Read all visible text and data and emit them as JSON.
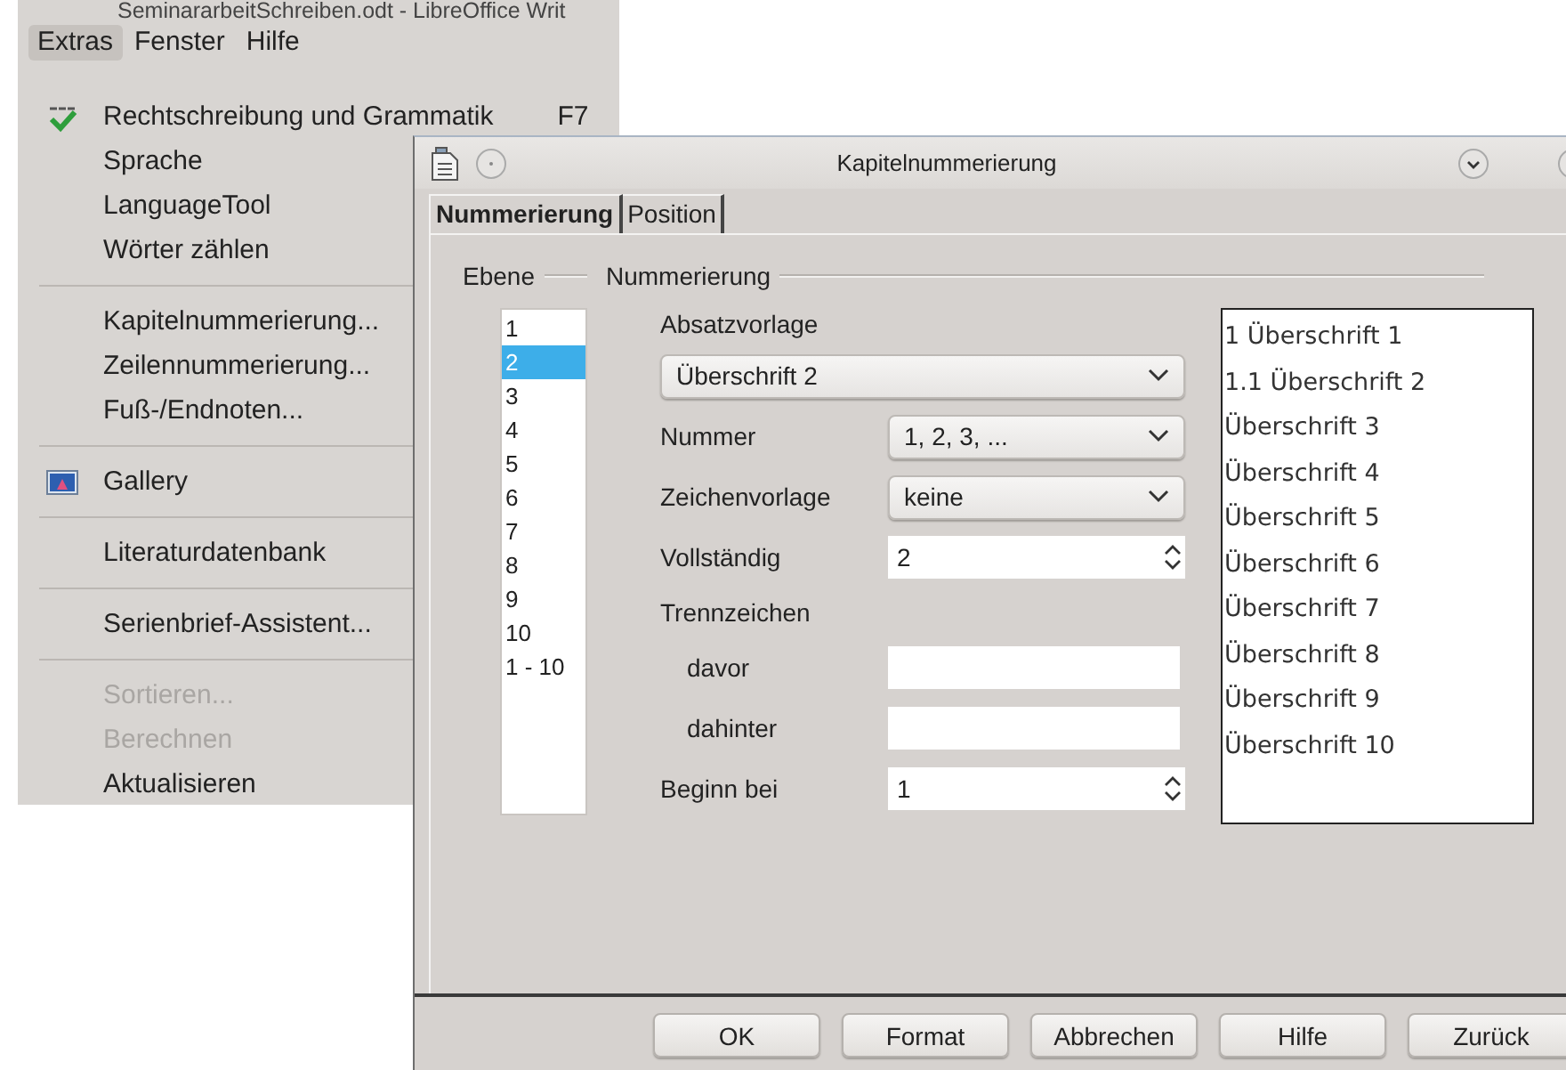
{
  "app_window": {
    "title": "SeminararbeitSchreiben.odt - LibreOffice Writ"
  },
  "menubar": [
    {
      "label": "Extras",
      "selected": true
    },
    {
      "label": "Fenster",
      "selected": false
    },
    {
      "label": "Hilfe",
      "selected": false
    }
  ],
  "menu": [
    {
      "kind": "item",
      "label": "Rechtschreibung und Grammatik",
      "shortcut": "F7",
      "disabled": false
    },
    {
      "kind": "item",
      "label": "Sprache",
      "disabled": false
    },
    {
      "kind": "item",
      "label": "LanguageTool",
      "disabled": false
    },
    {
      "kind": "item",
      "label": "Wörter zählen",
      "disabled": false
    },
    {
      "kind": "separator"
    },
    {
      "kind": "item",
      "label": "Kapitelnummerierung...",
      "disabled": false
    },
    {
      "kind": "item",
      "label": "Zeilennummerierung...",
      "disabled": false
    },
    {
      "kind": "item",
      "label": "Fuß-/Endnoten...",
      "disabled": false
    },
    {
      "kind": "separator"
    },
    {
      "kind": "item",
      "label": "Gallery",
      "disabled": false
    },
    {
      "kind": "separator"
    },
    {
      "kind": "item",
      "label": "Literaturdatenbank",
      "disabled": false
    },
    {
      "kind": "separator"
    },
    {
      "kind": "item",
      "label": "Serienbrief-Assistent...",
      "disabled": false
    },
    {
      "kind": "separator"
    },
    {
      "kind": "item",
      "label": "Sortieren...",
      "disabled": true
    },
    {
      "kind": "item",
      "label": "Berechnen",
      "disabled": true
    },
    {
      "kind": "item",
      "label": "Aktualisieren",
      "disabled": false
    }
  ],
  "dialog": {
    "title": "Kapitelnummerierung",
    "tabs": [
      {
        "label": "Nummerierung",
        "selected": true
      },
      {
        "label": "Position",
        "selected": false
      }
    ],
    "level_group": {
      "label": "Ebene",
      "levels": [
        {
          "label": "1",
          "selected": false
        },
        {
          "label": "2",
          "selected": true
        },
        {
          "label": "3",
          "selected": false
        },
        {
          "label": "4",
          "selected": false
        },
        {
          "label": "5",
          "selected": false
        },
        {
          "label": "6",
          "selected": false
        },
        {
          "label": "7",
          "selected": false
        },
        {
          "label": "8",
          "selected": false
        },
        {
          "label": "9",
          "selected": false
        },
        {
          "label": "10",
          "selected": false
        },
        {
          "label": "1 - 10",
          "selected": false
        }
      ]
    },
    "numbering_group": {
      "label": "Nummerierung",
      "fields": [
        {
          "kind": "label",
          "label": "Absatzvorlage"
        },
        {
          "kind": "wide_dropdown",
          "value": "Überschrift 2"
        },
        {
          "kind": "dropdown",
          "label": "Nummer",
          "value": "1, 2, 3, ..."
        },
        {
          "kind": "dropdown",
          "label": "Zeichenvorlage",
          "value": "keine"
        },
        {
          "kind": "spin",
          "label": "Vollständig",
          "value": "2"
        },
        {
          "kind": "label",
          "label": "Trennzeichen"
        },
        {
          "kind": "text",
          "label": "davor"
        },
        {
          "kind": "text",
          "label": "dahinter"
        },
        {
          "kind": "spin",
          "label": "Beginn bei",
          "value": "1"
        }
      ]
    },
    "preview": [
      "1 Überschrift 1",
      "1.1 Überschrift 2",
      "Überschrift 3",
      "Überschrift 4",
      "Überschrift 5",
      "Überschrift 6",
      "Überschrift 7",
      "Überschrift 8",
      "Überschrift 9",
      "Überschrift 10"
    ],
    "buttons": [
      "OK",
      "Format",
      "Abbrechen",
      "Hilfe",
      "Zurück"
    ]
  }
}
